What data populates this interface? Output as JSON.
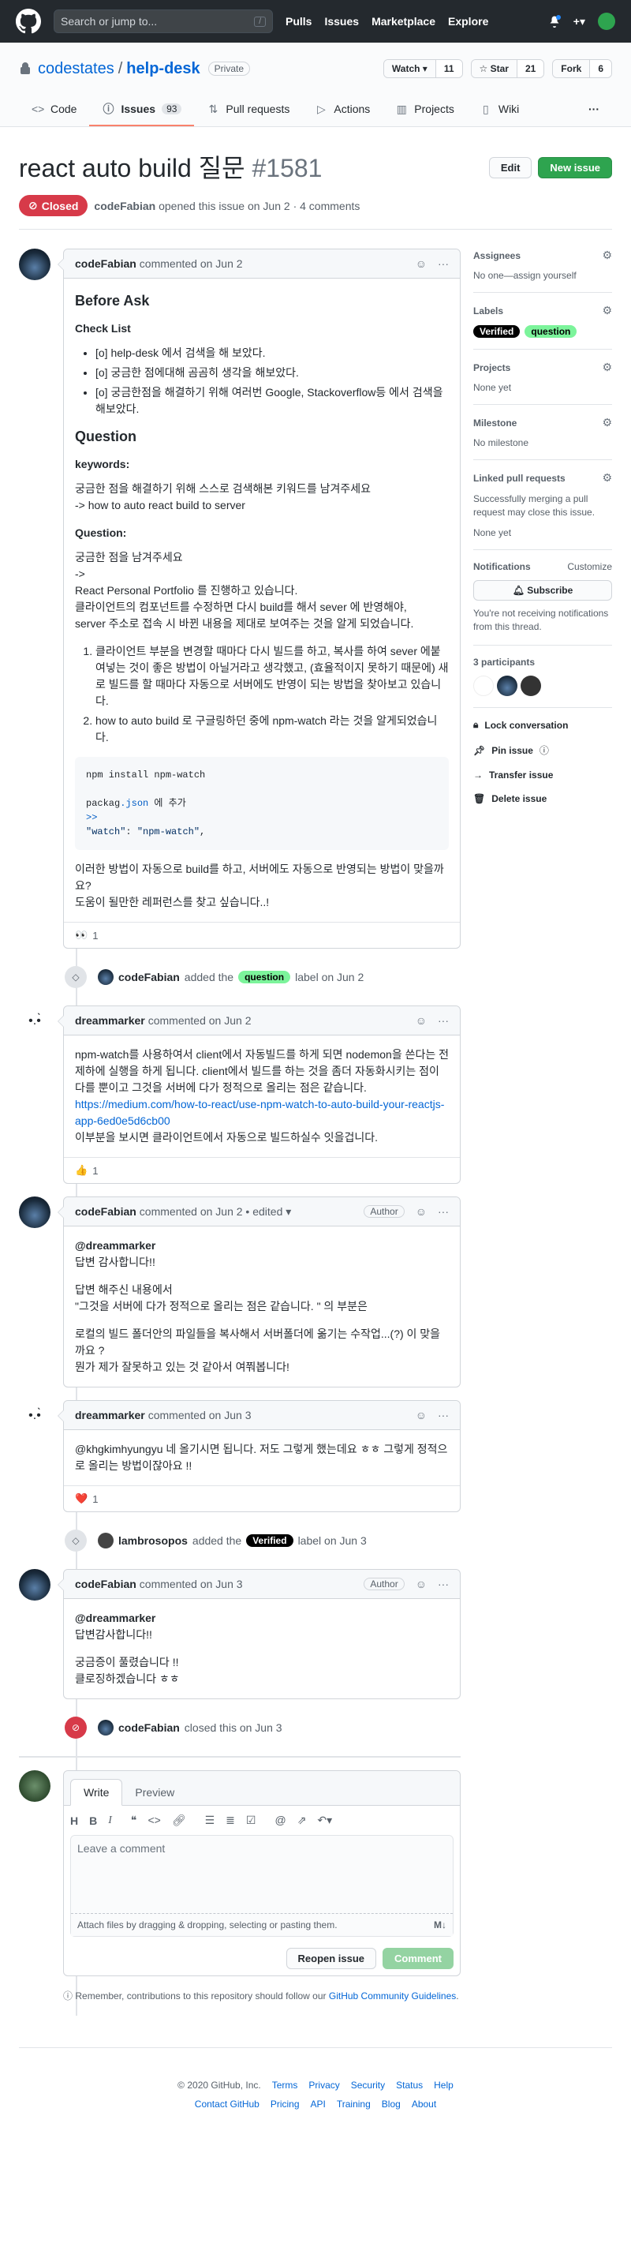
{
  "header": {
    "search_placeholder": "Search or jump to...",
    "search_shortcut": "/",
    "nav": [
      "Pulls",
      "Issues",
      "Marketplace",
      "Explore"
    ],
    "plus": "+▾"
  },
  "repo": {
    "owner": "codestates",
    "name": "help-desk",
    "visibility": "Private",
    "watch_label": "Watch ▾",
    "watch_count": "11",
    "star_label": "☆ Star",
    "star_count": "21",
    "fork_label": "Fork",
    "fork_count": "6",
    "tabs": [
      {
        "label": "Code"
      },
      {
        "label": "Issues",
        "count": "93"
      },
      {
        "label": "Pull requests"
      },
      {
        "label": "Actions"
      },
      {
        "label": "Projects"
      },
      {
        "label": "Wiki"
      }
    ],
    "more": "···"
  },
  "issue": {
    "title": "react auto build 질문",
    "number": "#1581",
    "edit_label": "Edit",
    "new_issue_label": "New issue",
    "state": "Closed",
    "author": "codeFabian",
    "meta": "opened this issue on Jun 2 · 4 comments"
  },
  "comments": {
    "c1": {
      "author": "codeFabian",
      "meta": "commented on Jun 2",
      "before_ask": "Before Ask",
      "check_list": "Check List",
      "checks": [
        "[o] help-desk 에서 검색을 해 보았다.",
        "[o] 궁금한 점에대해 곰곰히 생각을 해보았다.",
        "[o] 궁금한점을 해결하기 위해 여러번 Google, Stackoverflow등 에서 검색을 해보았다."
      ],
      "question_h": "Question",
      "keywords_h": "keywords:",
      "keywords_1": "궁금한 점을 해결하기 위해 스스로 검색해본 키워드를 남겨주세요",
      "keywords_2": "-> how to auto react build to server",
      "question_sub": "Question:",
      "q_1": "궁금한 점을 남겨주세요",
      "q_2": "->",
      "q_3": "React Personal Portfolio 를 진행하고 있습니다.",
      "q_4": "클라이언트의 컴포넌트를 수정하면 다시 build를 해서 sever 에 반영해야,",
      "q_5": "server 주소로 접속 시 바뀐 내용을 제대로 보여주는 것을 알게 되었습니다.",
      "ol_1": "클라이언트 부분을 변경할 때마다 다시 빌드를 하고, 복사를 하여 sever 에붙여넣는 것이 좋은 방법이 아닐거라고 생각했고, (효율적이지 못하기 때문에) 새로 빌드를 할 때마다 자동으로 서버에도 반영이 되는 방법을 찾아보고 있습니다.",
      "ol_2": "how to auto build 로 구글링하던 중에 npm-watch 라는 것을 알게되었습니다.",
      "code_1": "npm install npm-watch",
      "code_2a": "packag",
      "code_2b": ".json",
      "code_2c": " 에 추가",
      "code_3": ">>",
      "code_4a": "\"watch\"",
      "code_4b": ": ",
      "code_4c": "\"npm-watch\"",
      "code_4d": ",",
      "end_1": "이러한 방법이 자동으로 build를 하고, 서버에도 자동으로 반영되는 방법이 맞을까요?",
      "end_2": "도움이 될만한 레퍼런스를 찾고 싶습니다..!",
      "reaction_emoji": "👀",
      "reaction_count": "1"
    },
    "e1": {
      "actor": "codeFabian",
      "text": "added the",
      "label": "question",
      "suffix": "label on Jun 2"
    },
    "c2": {
      "author": "dreammarker",
      "meta": "commented on Jun 2",
      "body_1": "npm-watch를 사용하여서 client에서 자동빌드를 하게 되면 nodemon을 쓴다는 전제하에 실행을 하게 됩니다. client에서 빌드를 하는 것을 좀더 자동화시키는 점이 다를 뿐이고 그것을 서버에 다가 정적으로 올리는 점은 같습니다.",
      "link": "https://medium.com/how-to-react/use-npm-watch-to-auto-build-your-reactjs-app-6ed0e5d6cb00",
      "body_2": "이부분을 보시면 클라이언트에서 자동으로 빌드하실수 잇을겁니다.",
      "reaction_emoji": "👍",
      "reaction_count": "1"
    },
    "c3": {
      "author": "codeFabian",
      "meta": "commented on Jun 2 • edited ▾",
      "badge": "Author",
      "b1": "@dreammarker",
      "b2": "답변 감사합니다!!",
      "b3": "답변 해주신 내용에서",
      "b4": "\"그것을 서버에 다가 정적으로 올리는 점은 같습니다. \" 의 부분은",
      "b5": "로컬의 빌드 폴더안의 파일들을 복사해서 서버폴더에 옮기는 수작업...(?) 이 맞을까요 ?",
      "b6": "뭔가 제가 잘못하고 있는 것 같아서 여쭤봅니다!"
    },
    "c4": {
      "author": "dreammarker",
      "meta": "commented on Jun 3",
      "body": "@khgkimhyungyu 네 올기시면 됩니다. 저도 그렇게 했는데요 ㅎㅎ 그렇게 정적으로 올리는 방법이잖아요 !!",
      "reaction_emoji": "❤️",
      "reaction_count": "1"
    },
    "e2": {
      "actor": "lambrosopos",
      "text": "added the",
      "label": "Verified",
      "suffix": "label on Jun 3"
    },
    "c5": {
      "author": "codeFabian",
      "meta": "commented on Jun 3",
      "badge": "Author",
      "b1": "@dreammarker",
      "b2": "답변감사합니다!!",
      "b3": "궁금증이 풀렸습니다 !!",
      "b4": "클로징하겠습니다 ㅎㅎ"
    },
    "e3": {
      "actor": "codeFabian",
      "text": "closed this on Jun 3"
    }
  },
  "form": {
    "tab_write": "Write",
    "tab_preview": "Preview",
    "placeholder": "Leave a comment",
    "attach": "Attach files by dragging & dropping, selecting or pasting them.",
    "reopen": "Reopen issue",
    "comment": "Comment",
    "remember_1": "Remember, contributions to this repository should follow our",
    "remember_link": "GitHub Community Guidelines",
    "remember_2": "."
  },
  "sidebar": {
    "assignees_h": "Assignees",
    "assignees_v": "No one—assign yourself",
    "labels_h": "Labels",
    "labels": [
      "Verified",
      "question"
    ],
    "projects_h": "Projects",
    "projects_v": "None yet",
    "milestone_h": "Milestone",
    "milestone_v": "No milestone",
    "linked_h": "Linked pull requests",
    "linked_desc": "Successfully merging a pull request may close this issue.",
    "linked_v": "None yet",
    "notif_h": "Notifications",
    "notif_customize": "Customize",
    "subscribe": "Subscribe",
    "notif_desc": "You're not receiving notifications from this thread.",
    "participants_h": "3 participants",
    "lock": "Lock conversation",
    "pin": "Pin issue",
    "transfer": "Transfer issue",
    "delete": "Delete issue"
  },
  "footer": {
    "copy": "© 2020 GitHub, Inc.",
    "row1": [
      "Terms",
      "Privacy",
      "Security",
      "Status",
      "Help"
    ],
    "row2": [
      "Contact GitHub",
      "Pricing",
      "API",
      "Training",
      "Blog",
      "About"
    ]
  },
  "colors": {
    "header_bg": "#24292e",
    "closed": "#d73a49",
    "green": "#2ea44f",
    "link": "#0366d6",
    "label_question": "#7cf49b",
    "label_verified": "#000000"
  }
}
